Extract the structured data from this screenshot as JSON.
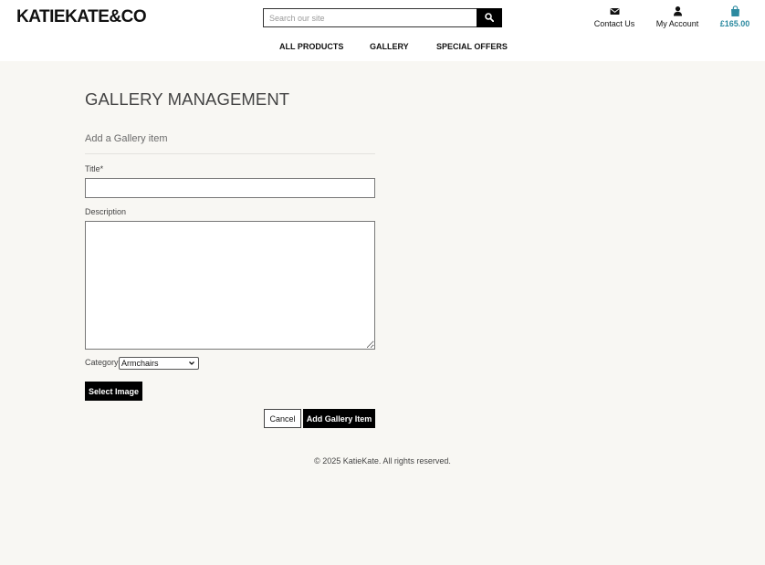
{
  "header": {
    "logo": "KATIEKATE&CO",
    "search_placeholder": "Search our site",
    "search_value": "",
    "nav": [
      "ALL PRODUCTS",
      "GALLERY",
      "SPECIAL OFFERS"
    ],
    "contact_label": "Contact Us",
    "account_label": "My Account",
    "basket_total": "£165.00",
    "icons": {
      "contact": "envelope-icon",
      "account": "user-icon",
      "basket": "shopping-bag-icon",
      "search": "search-icon"
    },
    "accent_color": "#2c8aa0"
  },
  "main": {
    "title": "GALLERY MANAGEMENT",
    "subtitle": "Add a Gallery item",
    "form": {
      "title_label": "Title*",
      "title_value": "",
      "description_label": "Description",
      "description_value": "",
      "category_label": "Category",
      "category_value": "Armchairs",
      "select_image_label": "Select Image",
      "cancel_label": "Cancel",
      "submit_label": "Add Gallery Item"
    }
  },
  "footer": {
    "text": "© 2025 KatieKate. All rights reserved."
  }
}
